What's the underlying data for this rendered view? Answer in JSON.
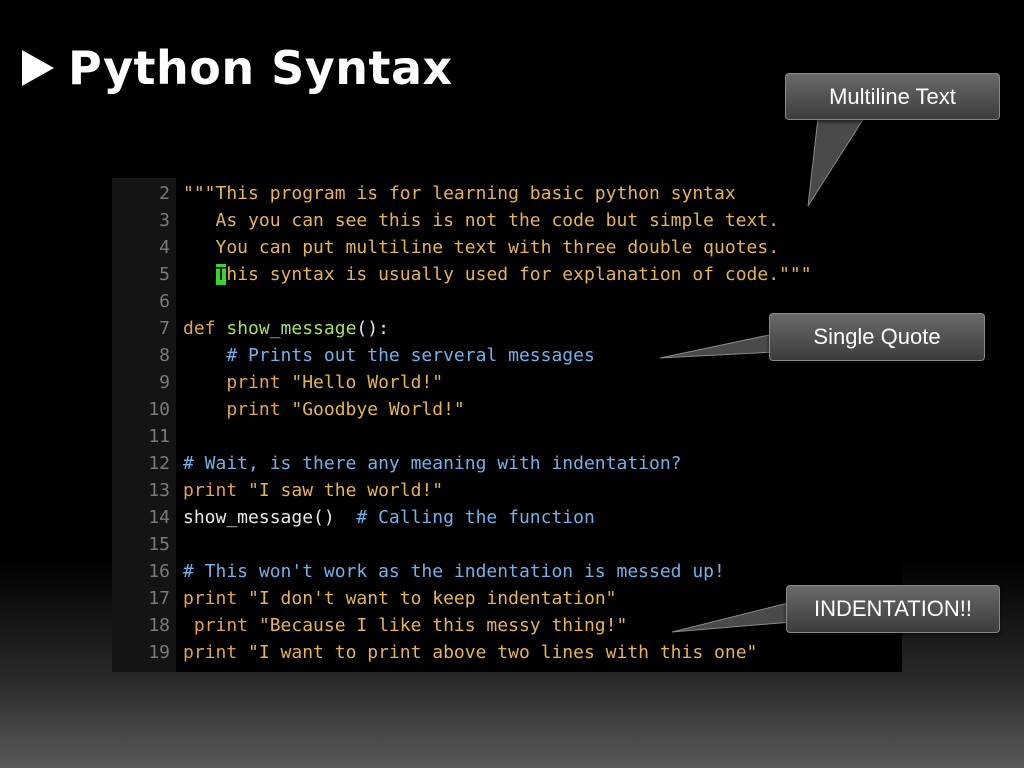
{
  "slide": {
    "title": "Python Syntax"
  },
  "editor": {
    "lines": [
      {
        "num": "2",
        "segments": [
          {
            "cls": "str",
            "text": "\"\"\"This program is for learning basic python syntax"
          }
        ]
      },
      {
        "num": "3",
        "segments": [
          {
            "cls": "str",
            "text": "   As you can see this is not the code but simple text."
          }
        ]
      },
      {
        "num": "4",
        "segments": [
          {
            "cls": "str",
            "text": "   You can put multiline text with three double quotes."
          }
        ]
      },
      {
        "num": "5",
        "segments": [
          {
            "cls": "str",
            "text": "   "
          },
          {
            "cls": "cursor",
            "text": "T"
          },
          {
            "cls": "str",
            "text": "his syntax is usually used for explanation of code.\"\"\""
          }
        ]
      },
      {
        "num": "6",
        "segments": []
      },
      {
        "num": "7",
        "segments": [
          {
            "cls": "kw",
            "text": "def "
          },
          {
            "cls": "fn",
            "text": "show_message"
          },
          {
            "cls": "plain",
            "text": "():"
          }
        ]
      },
      {
        "num": "8",
        "segments": [
          {
            "cls": "cmt",
            "text": "    # Prints out the serveral messages"
          }
        ]
      },
      {
        "num": "9",
        "segments": [
          {
            "cls": "kw",
            "text": "    print "
          },
          {
            "cls": "str",
            "text": "\"Hello World!\""
          }
        ]
      },
      {
        "num": "10",
        "segments": [
          {
            "cls": "kw",
            "text": "    print "
          },
          {
            "cls": "str",
            "text": "\"Goodbye World!\""
          }
        ]
      },
      {
        "num": "11",
        "segments": []
      },
      {
        "num": "12",
        "segments": [
          {
            "cls": "cmt",
            "text": "# Wait, is there any meaning with indentation?"
          }
        ]
      },
      {
        "num": "13",
        "segments": [
          {
            "cls": "kw",
            "text": "print "
          },
          {
            "cls": "str",
            "text": "\"I saw the world!\""
          }
        ]
      },
      {
        "num": "14",
        "segments": [
          {
            "cls": "plain",
            "text": "show_message()  "
          },
          {
            "cls": "cmt",
            "text": "# Calling the function"
          }
        ]
      },
      {
        "num": "15",
        "segments": []
      },
      {
        "num": "16",
        "segments": [
          {
            "cls": "cmt",
            "text": "# This won't work as the indentation is messed up!"
          }
        ]
      },
      {
        "num": "17",
        "segments": [
          {
            "cls": "kw",
            "text": "print "
          },
          {
            "cls": "str",
            "text": "\"I don't want to keep indentation\""
          }
        ]
      },
      {
        "num": "18",
        "segments": [
          {
            "cls": "kw",
            "text": " print "
          },
          {
            "cls": "str",
            "text": "\"Because I like this messy thing!\""
          }
        ]
      },
      {
        "num": "19",
        "segments": [
          {
            "cls": "kw",
            "text": "print "
          },
          {
            "cls": "str",
            "text": "\"I want to print above two lines with this one\""
          }
        ]
      }
    ]
  },
  "callouts": {
    "multiline": "Multiline Text",
    "single_quote": "Single Quote",
    "indentation": "INDENTATION!!"
  }
}
